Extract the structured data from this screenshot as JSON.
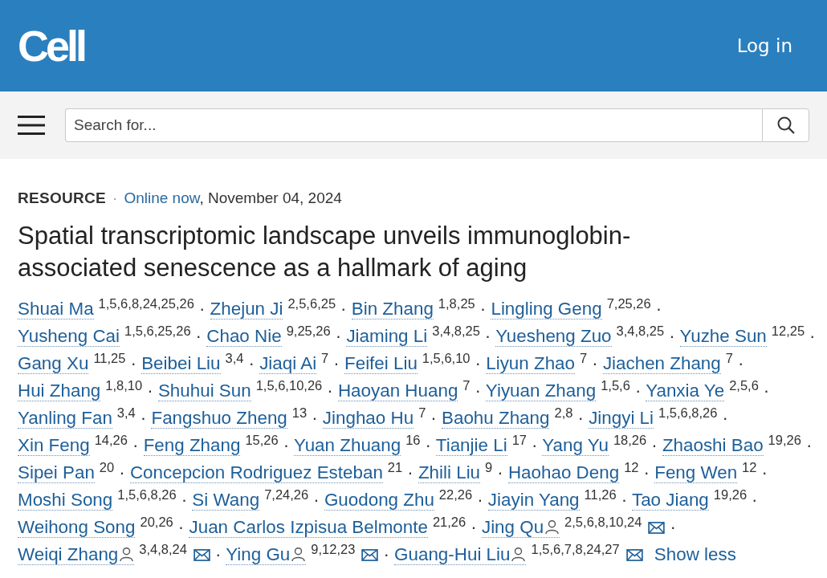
{
  "header": {
    "logo": "Cell",
    "login": "Log in"
  },
  "search": {
    "placeholder": "Search for..."
  },
  "article": {
    "type": "RESOURCE",
    "type_separator": "·",
    "status": "Online now",
    "date": ", November 04, 2024",
    "title": "Spatial transcriptomic landscape unveils immunoglobin-associated senescence as a hallmark of aging"
  },
  "author_separator": "·",
  "authors": [
    {
      "name": "Shuai Ma",
      "affiliations": "1,5,6,8,24,25,26",
      "corresponding": false
    },
    {
      "name": "Zhejun Ji",
      "affiliations": "2,5,6,25",
      "corresponding": false
    },
    {
      "name": "Bin Zhang",
      "affiliations": "1,8,25",
      "corresponding": false
    },
    {
      "name": "Lingling Geng",
      "affiliations": "7,25,26",
      "corresponding": false
    },
    {
      "name": "Yusheng Cai",
      "affiliations": "1,5,6,25,26",
      "corresponding": false
    },
    {
      "name": "Chao Nie",
      "affiliations": "9,25,26",
      "corresponding": false
    },
    {
      "name": "Jiaming Li",
      "affiliations": "3,4,8,25",
      "corresponding": false
    },
    {
      "name": "Yuesheng Zuo",
      "affiliations": "3,4,8,25",
      "corresponding": false
    },
    {
      "name": "Yuzhe Sun",
      "affiliations": "12,25",
      "corresponding": false
    },
    {
      "name": "Gang Xu",
      "affiliations": "11,25",
      "corresponding": false
    },
    {
      "name": "Beibei Liu",
      "affiliations": "3,4",
      "corresponding": false
    },
    {
      "name": "Jiaqi Ai",
      "affiliations": "7",
      "corresponding": false
    },
    {
      "name": "Feifei Liu",
      "affiliations": "1,5,6,10",
      "corresponding": false
    },
    {
      "name": "Liyun Zhao",
      "affiliations": "7",
      "corresponding": false
    },
    {
      "name": "Jiachen Zhang",
      "affiliations": "7",
      "corresponding": false
    },
    {
      "name": "Hui Zhang",
      "affiliations": "1,8,10",
      "corresponding": false
    },
    {
      "name": "Shuhui Sun",
      "affiliations": "1,5,6,10,26",
      "corresponding": false
    },
    {
      "name": "Haoyan Huang",
      "affiliations": "7",
      "corresponding": false
    },
    {
      "name": "Yiyuan Zhang",
      "affiliations": "1,5,6",
      "corresponding": false
    },
    {
      "name": "Yanxia Ye",
      "affiliations": "2,5,6",
      "corresponding": false
    },
    {
      "name": "Yanling Fan",
      "affiliations": "3,4",
      "corresponding": false
    },
    {
      "name": "Fangshuo Zheng",
      "affiliations": "13",
      "corresponding": false
    },
    {
      "name": "Jinghao Hu",
      "affiliations": "7",
      "corresponding": false
    },
    {
      "name": "Baohu Zhang",
      "affiliations": "2,8",
      "corresponding": false
    },
    {
      "name": "Jingyi Li",
      "affiliations": "1,5,6,8,26",
      "corresponding": false
    },
    {
      "name": "Xin Feng",
      "affiliations": "14,26",
      "corresponding": false
    },
    {
      "name": "Feng Zhang",
      "affiliations": "15,26",
      "corresponding": false
    },
    {
      "name": "Yuan Zhuang",
      "affiliations": "16",
      "corresponding": false
    },
    {
      "name": "Tianjie Li",
      "affiliations": "17",
      "corresponding": false
    },
    {
      "name": "Yang Yu",
      "affiliations": "18,26",
      "corresponding": false
    },
    {
      "name": "Zhaoshi Bao",
      "affiliations": "19,26",
      "corresponding": false
    },
    {
      "name": "Sipei Pan",
      "affiliations": "20",
      "corresponding": false
    },
    {
      "name": "Concepcion Rodriguez Esteban",
      "affiliations": "21",
      "corresponding": false
    },
    {
      "name": "Zhili Liu",
      "affiliations": "9",
      "corresponding": false
    },
    {
      "name": "Haohao Deng",
      "affiliations": "12",
      "corresponding": false
    },
    {
      "name": "Feng Wen",
      "affiliations": "12",
      "corresponding": false
    },
    {
      "name": "Moshi Song",
      "affiliations": "1,5,6,8,26",
      "corresponding": false
    },
    {
      "name": "Si Wang",
      "affiliations": "7,24,26",
      "corresponding": false
    },
    {
      "name": "Guodong Zhu",
      "affiliations": "22,26",
      "corresponding": false
    },
    {
      "name": "Jiayin Yang",
      "affiliations": "11,26",
      "corresponding": false
    },
    {
      "name": "Tao Jiang",
      "affiliations": "19,26",
      "corresponding": false
    },
    {
      "name": "Weihong Song",
      "affiliations": "20,26",
      "corresponding": false
    },
    {
      "name": "Juan Carlos Izpisua Belmonte",
      "affiliations": "21,26",
      "corresponding": false
    },
    {
      "name": "Jing Qu",
      "affiliations": "2,5,6,8,10,24",
      "corresponding": true
    },
    {
      "name": "Weiqi Zhang",
      "affiliations": "3,4,8,24",
      "corresponding": true
    },
    {
      "name": "Ying Gu",
      "affiliations": "9,12,23",
      "corresponding": true
    },
    {
      "name": "Guang-Hui Liu",
      "affiliations": "1,5,6,7,8,24,27",
      "corresponding": true
    }
  ],
  "show_less": "Show less"
}
